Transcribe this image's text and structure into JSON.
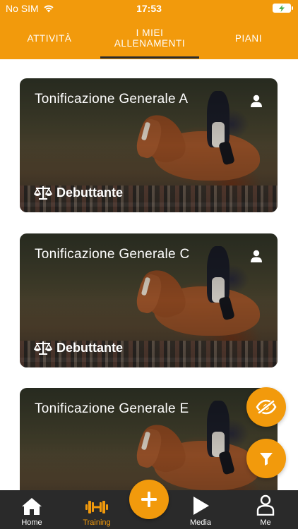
{
  "status_bar": {
    "carrier": "No SIM",
    "time": "17:53"
  },
  "tabs": [
    {
      "label": "ATTIVITÀ"
    },
    {
      "label": "I MIEI\nALLENAMENTI"
    },
    {
      "label": "PIANI"
    }
  ],
  "workouts": [
    {
      "title": "Tonificazione Generale A",
      "level": "Debuttante"
    },
    {
      "title": "Tonificazione Generale C",
      "level": "Debuttante"
    },
    {
      "title": "Tonificazione Generale E",
      "level": ""
    }
  ],
  "bottom_nav": {
    "home": "Home",
    "training": "Training",
    "media": "Media",
    "me": "Me"
  },
  "colors": {
    "accent": "#F29A0C",
    "nav_bg": "#2a2a2a"
  },
  "icons": [
    "wifi-icon",
    "battery-charging-icon",
    "user-icon",
    "scale-icon",
    "eye-slash-icon",
    "filter-icon",
    "home-icon",
    "dumbbell-icon",
    "plus-icon",
    "play-icon",
    "person-icon"
  ]
}
